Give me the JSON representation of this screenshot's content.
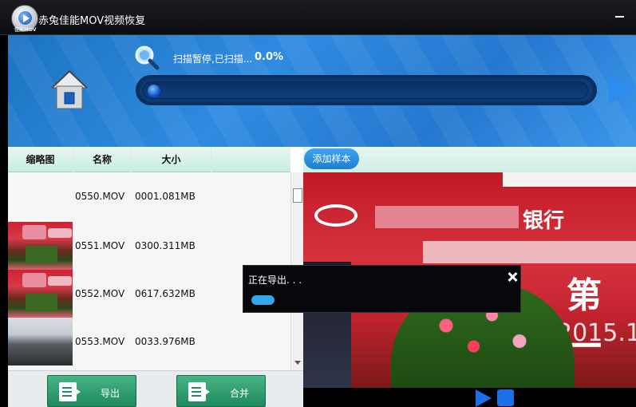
{
  "window": {
    "title": "赤兔佳能MOV视频恢复",
    "logo_caption": "佳能MOV"
  },
  "scan": {
    "status": "扫描暂停,已扫描...",
    "percent_text": "0.0%",
    "progress": 0.0
  },
  "table": {
    "headers": {
      "thumb": "缩略图",
      "name": "名称",
      "size": "大小"
    },
    "rows": [
      {
        "name": "0550.MOV",
        "size": "0001.081MB",
        "thumb": "none"
      },
      {
        "name": "0551.MOV",
        "size": "0300.311MB",
        "thumb": "red-banner"
      },
      {
        "name": "0552.MOV",
        "size": "0617.632MB",
        "thumb": "red-banner"
      },
      {
        "name": "0553.MOV",
        "size": "0033.976MB",
        "thumb": "conference-room"
      }
    ]
  },
  "buttons": {
    "export": "导出",
    "merge": "合并",
    "add_sample": "添加样本"
  },
  "preview": {
    "banner_text": "银行",
    "banner_big": "第一",
    "banner_year": "2015.1"
  },
  "dialog": {
    "message": "正在导出. . .",
    "progress": 0.05
  },
  "colors": {
    "header_blue": "#2f8be0",
    "button_green": "#1e8a5e",
    "accent_blue": "#1c6fe8",
    "banner_red": "#c01a26"
  },
  "icons": {
    "home": "home-icon",
    "scan": "magnifier-icon",
    "next": "arrow-right-icon",
    "close": "close-icon",
    "play": "play-icon",
    "stop": "stop-icon"
  }
}
